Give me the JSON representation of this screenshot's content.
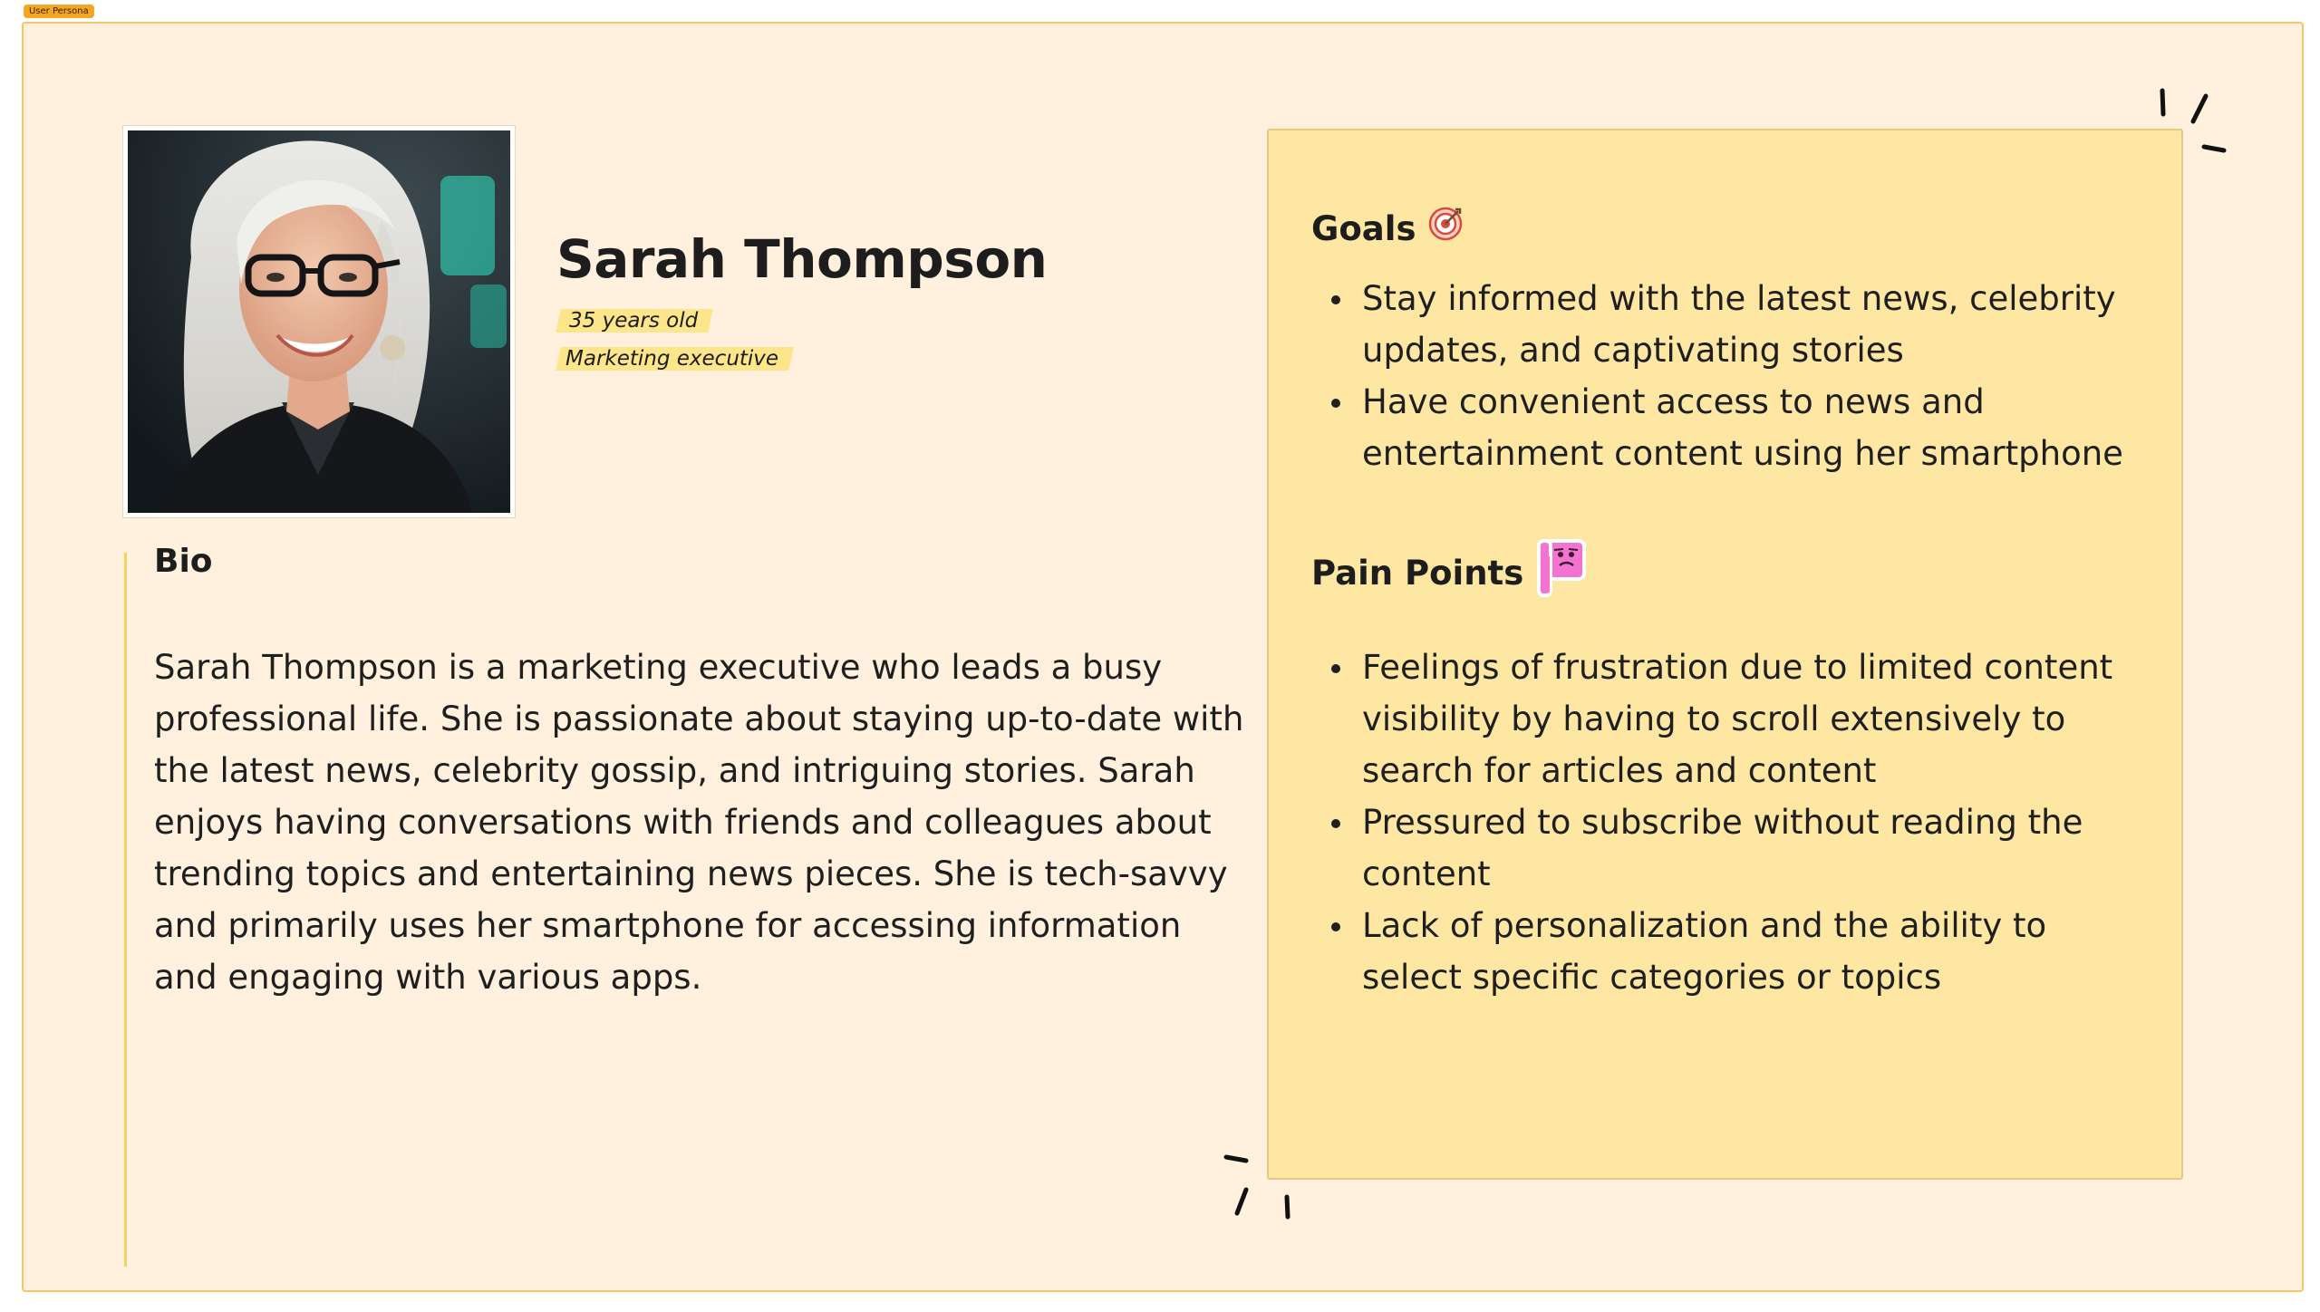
{
  "frame": {
    "tag": "User Persona"
  },
  "persona": {
    "name": "Sarah Thompson",
    "age": "35 years old",
    "occupation": "Marketing executive"
  },
  "bio": {
    "title": "Bio",
    "text": "Sarah Thompson is a marketing executive who leads a busy professional life. She is passionate about staying up-to-date with the latest news, celebrity gossip, and intriguing stories. Sarah enjoys having conversations with friends and colleagues about trending topics and entertaining news pieces. She is tech-savvy and primarily uses her smartphone for accessing information and engaging with various apps."
  },
  "goals": {
    "title": "Goals",
    "icon": "target-icon",
    "items": [
      "Stay informed with the latest news, celebrity updates, and captivating stories",
      "Have convenient access to news and entertainment content using her smartphone"
    ]
  },
  "pain_points": {
    "title": "Pain Points",
    "icon": "pink-flag-face-icon",
    "items": [
      "Feelings of frustration due to limited content visibility by having to scroll extensively to search for articles and content",
      "Pressured to subscribe without reading the content",
      "Lack of personalization and the ability to select specific categories or topics"
    ]
  },
  "colors": {
    "frame_bg": "#fff1dd",
    "frame_border": "#f3c76c",
    "card_bg": "#fee6a3",
    "highlight": "#fde68a",
    "accent_pink": "#f472d0"
  }
}
